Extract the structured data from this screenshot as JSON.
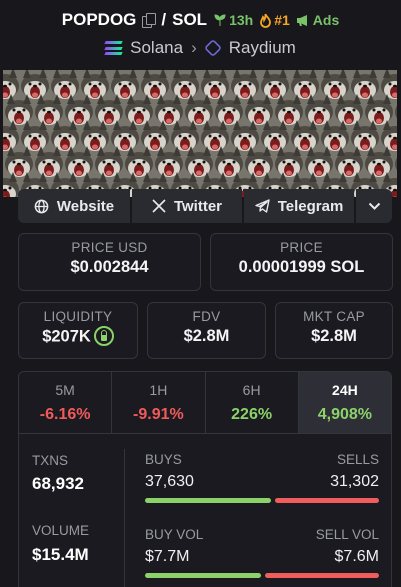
{
  "header": {
    "token": "POPDOG",
    "separator": "/",
    "quote": "SOL",
    "age": "13h",
    "rank": "#1",
    "ads": "Ads",
    "chain": "Solana",
    "dex": "Raydium"
  },
  "links": {
    "website": "Website",
    "twitter": "Twitter",
    "telegram": "Telegram"
  },
  "price": {
    "usd_label": "PRICE USD",
    "usd_value": "$0.002844",
    "native_label": "PRICE",
    "native_value": "0.00001999 SOL"
  },
  "metrics": {
    "liquidity_label": "LIQUIDITY",
    "liquidity_value": "$207K",
    "fdv_label": "FDV",
    "fdv_value": "$2.8M",
    "mktcap_label": "MKT CAP",
    "mktcap_value": "$2.8M"
  },
  "timeframes": [
    {
      "label": "5M",
      "value": "-6.16%"
    },
    {
      "label": "1H",
      "value": "-9.91%"
    },
    {
      "label": "6H",
      "value": "226%"
    },
    {
      "label": "24H",
      "value": "4,908%"
    }
  ],
  "stats": {
    "txns_label": "TXNS",
    "txns_value": "68,932",
    "buys_label": "BUYS",
    "buys_value": "37,630",
    "sells_label": "SELLS",
    "sells_value": "31,302",
    "volume_label": "VOLUME",
    "volume_value": "$15.4M",
    "buy_vol_label": "BUY VOL",
    "buy_vol_value": "$7.7M",
    "sell_vol_label": "SELL VOL",
    "sell_vol_value": "$7.6M",
    "buy_ratio": 0.546,
    "buy_vol_ratio": 0.503
  },
  "colors": {
    "positive": "#8bd26a",
    "negative": "#f05a5a",
    "rank": "#f5a623"
  }
}
